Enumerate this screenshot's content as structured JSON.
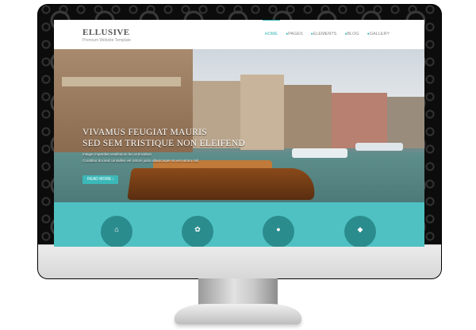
{
  "site": {
    "logo_title": "ELLUSIVE",
    "logo_tagline": "Premium Website Template"
  },
  "nav": {
    "items": [
      {
        "label": "HOME",
        "active": true
      },
      {
        "label": "PAGES",
        "active": false
      },
      {
        "label": "ELEMENTS",
        "active": false
      },
      {
        "label": "BLOG",
        "active": false
      },
      {
        "label": "GALLERY",
        "active": false
      }
    ]
  },
  "hero": {
    "title_line1": "VIVAMUS FEUGIAT MAURIS",
    "title_line2": "SED SEM TRISTIQUE NON ELEIFEND",
    "text_line1": "Integer imperdiet vestibulum leo ut tincidunt",
    "text_line2": "Curabitur dui sed consulles vel rutrum justo ullamcorper sit vel rutrum nisl",
    "read_more_label": "READ MORE ›"
  },
  "features": {
    "icons": [
      "home-icon",
      "ribbon-icon",
      "chat-icon",
      "tag-icon"
    ]
  },
  "colors": {
    "accent": "#3cb8b8",
    "band": "#4fc1c3",
    "feature_circle": "#2b8c8e"
  }
}
